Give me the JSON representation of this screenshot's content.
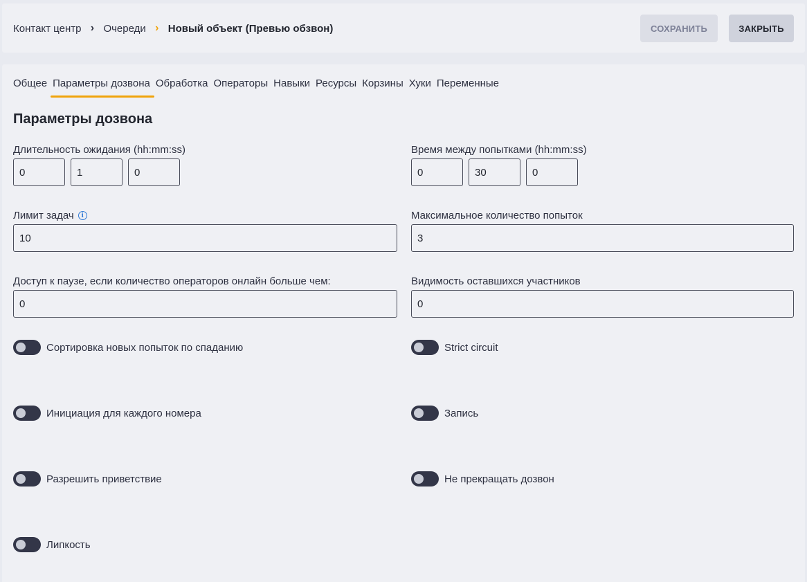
{
  "breadcrumb": {
    "items": [
      "Контакт центр",
      "Очереди",
      "Новый объект (Превью обзвон)"
    ],
    "separator": "›"
  },
  "toolbar": {
    "save_label": "СОХРАНИТЬ",
    "close_label": "ЗАКРЫТЬ"
  },
  "tabs": [
    {
      "label": "Общее",
      "active": false
    },
    {
      "label": "Параметры дозвона",
      "active": true
    },
    {
      "label": "Обработка",
      "active": false
    },
    {
      "label": "Операторы",
      "active": false
    },
    {
      "label": "Навыки",
      "active": false
    },
    {
      "label": "Ресурсы",
      "active": false
    },
    {
      "label": "Корзины",
      "active": false
    },
    {
      "label": "Хуки",
      "active": false
    },
    {
      "label": "Переменные",
      "active": false
    }
  ],
  "section_title": "Параметры дозвона",
  "fields": {
    "wait_duration": {
      "label": "Длительность ожидания (hh:mm:ss)",
      "hh": "0",
      "mm": "1",
      "ss": "0"
    },
    "retry_interval": {
      "label": "Время между попытками (hh:mm:ss)",
      "hh": "0",
      "mm": "30",
      "ss": "0"
    },
    "task_limit": {
      "label": "Лимит задач",
      "value": "10"
    },
    "max_attempts": {
      "label": "Максимальное количество попыток",
      "value": "3"
    },
    "pause_access": {
      "label": "Доступ к паузе, если количество операторов онлайн больше чем:",
      "value": "0"
    },
    "remaining_visibility": {
      "label": "Видимость оставшихся участников",
      "value": "0"
    }
  },
  "toggles": {
    "sort_desc": {
      "label": "Сортировка новых попыток по спаданию",
      "on": false
    },
    "strict_circuit": {
      "label": "Strict circuit",
      "on": false
    },
    "init_each_number": {
      "label": "Инициация для каждого номера",
      "on": false
    },
    "recording": {
      "label": "Запись",
      "on": false
    },
    "allow_greeting": {
      "label": "Разрешить приветствие",
      "on": false
    },
    "no_stop_dialing": {
      "label": "Не прекращать дозвон",
      "on": false
    },
    "stickiness": {
      "label": "Липкость",
      "on": false
    }
  },
  "colors": {
    "accent": "#f0a30a",
    "info": "#2f7ad6",
    "toggle_off": "#333648"
  },
  "icons": {
    "info": "info-icon"
  }
}
